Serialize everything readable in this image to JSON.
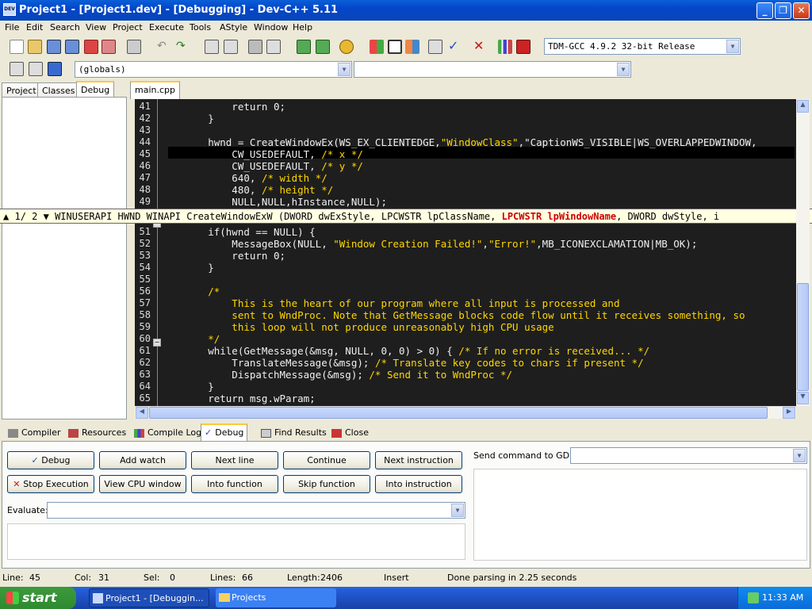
{
  "title": "Project1 - [Project1.dev] - [Debugging] - Dev-C++ 5.11",
  "menu": [
    "File",
    "Edit",
    "Search",
    "View",
    "Project",
    "Execute",
    "Tools",
    "AStyle",
    "Window",
    "Help"
  ],
  "compiler_select": "TDM-GCC 4.9.2 32-bit Release",
  "scope_select": "(globals)",
  "left_tabs": [
    "Project",
    "Classes",
    "Debug"
  ],
  "editor_tab": "main.cpp",
  "code_lines": [
    {
      "n": "41",
      "html": "            return 0;"
    },
    {
      "n": "42",
      "html": "        }"
    },
    {
      "n": "43",
      "html": ""
    },
    {
      "n": "44",
      "html": "        hwnd = CreateWindowEx(WS_EX_CLIENTEDGE,\"WindowClass\",\"CaptionWS_VISIBLE|WS_OVERLAPPEDWINDOW,"
    },
    {
      "n": "45",
      "html": "            CW_USEDEFAULT, /* x */"
    },
    {
      "n": "46",
      "html": "            CW_USEDEFAULT, /* y */"
    },
    {
      "n": "47",
      "html": "            640, /* width */"
    },
    {
      "n": "48",
      "html": "            480, /* height */"
    },
    {
      "n": "49",
      "html": "            NULL,NULL,hInstance,NULL);"
    },
    {
      "n": "51",
      "html": "        if(hwnd == NULL) {"
    },
    {
      "n": "52",
      "html": "            MessageBox(NULL, \"Window Creation Failed!\",\"Error!\",MB_ICONEXCLAMATION|MB_OK);"
    },
    {
      "n": "53",
      "html": "            return 0;"
    },
    {
      "n": "54",
      "html": "        }"
    },
    {
      "n": "55",
      "html": ""
    },
    {
      "n": "56",
      "html": "        /*"
    },
    {
      "n": "57",
      "html": "            This is the heart of our program where all input is processed and"
    },
    {
      "n": "58",
      "html": "            sent to WndProc. Note that GetMessage blocks code flow until it receives something, so"
    },
    {
      "n": "59",
      "html": "            this loop will not produce unreasonably high CPU usage"
    },
    {
      "n": "60",
      "html": "        */"
    },
    {
      "n": "61",
      "html": "        while(GetMessage(&msg, NULL, 0, 0) > 0) { /* If no error is received... */"
    },
    {
      "n": "62",
      "html": "            TranslateMessage(&msg); /* Translate key codes to chars if present */"
    },
    {
      "n": "63",
      "html": "            DispatchMessage(&msg); /* Send it to WndProc */"
    },
    {
      "n": "64",
      "html": "        }"
    },
    {
      "n": "65",
      "html": "        return msg.wParam;"
    },
    {
      "n": "66",
      "html": "    }"
    }
  ],
  "tooltip": {
    "counter": "1/ 2",
    "before": "WINUSERAPI HWND WINAPI CreateWindowExW (DWORD dwExStyle, LPCWSTR lpClassName, ",
    "highlight": "LPCWSTR lpWindowName",
    "after": ", DWORD dwStyle, i"
  },
  "bottom_tabs": [
    "Compiler",
    "Resources",
    "Compile Log",
    "Debug",
    "Find Results",
    "Close"
  ],
  "debug_buttons": {
    "debug": "Debug",
    "add_watch": "Add watch",
    "next_line": "Next line",
    "continue": "Continue",
    "next_instruction": "Next instruction",
    "stop": "Stop Execution",
    "cpu": "View CPU window",
    "into_function": "Into function",
    "skip_function": "Skip function",
    "into_instruction": "Into instruction"
  },
  "evaluate_label": "Evaluate:",
  "gdb_label": "Send command to GDB:",
  "status": {
    "line_label": "Line:",
    "line": "45",
    "col_label": "Col:",
    "col": "31",
    "sel_label": "Sel:",
    "sel": "0",
    "lines_label": "Lines:",
    "lines": "66",
    "length_label": "Length:",
    "length": "2406",
    "mode": "Insert",
    "message": "Done parsing in 2.25 seconds"
  },
  "taskbar": {
    "start": "start",
    "task1": "Project1 - [Debuggin...",
    "task2": "Projects",
    "clock": "11:33 AM"
  }
}
